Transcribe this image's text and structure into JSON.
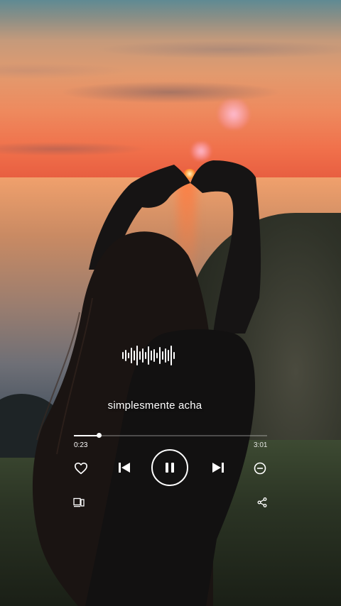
{
  "player": {
    "song_title": "simplesmente acha",
    "current_time": "0:23",
    "total_time": "3:01",
    "progress": 0.127
  },
  "icons": {
    "waveform": "waveform-icon",
    "like": "heart-outline-icon",
    "previous": "skip-previous-icon",
    "pause": "pause-icon",
    "next": "skip-next-icon",
    "remove": "minus-circle-icon",
    "device": "connect-device-icon",
    "share": "share-icon"
  },
  "colors": {
    "accent": "#ffffff"
  }
}
